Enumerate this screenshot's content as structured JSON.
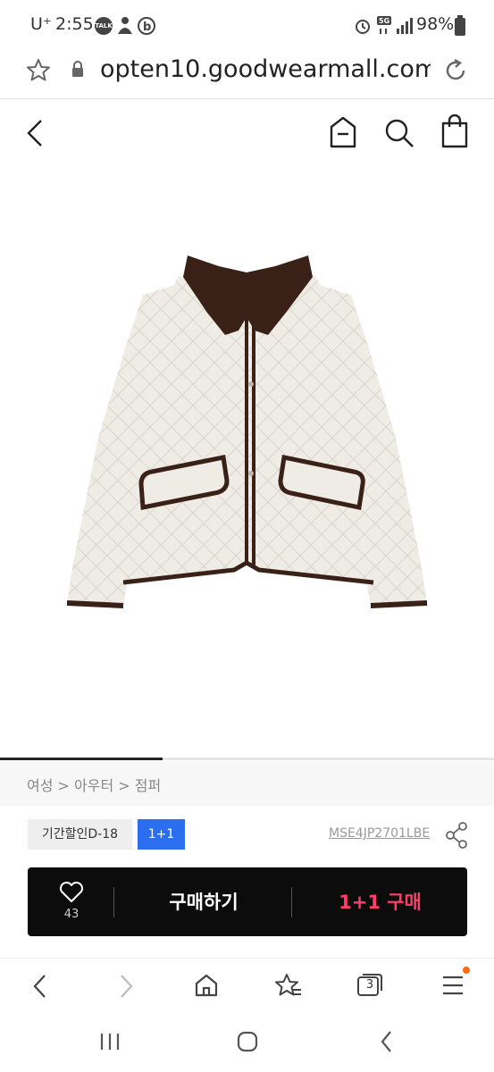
{
  "status_bar": {
    "carrier": "U⁺",
    "time": "2:55",
    "notification_icons": [
      "talk-icon",
      "person-icon",
      "b-icon"
    ],
    "system_icons": [
      "alarm-icon",
      "5g-icon",
      "signal-icon"
    ],
    "talk_text": "TALK",
    "network": "5G",
    "battery_percent": "98%"
  },
  "url_bar": {
    "url": "opten10.goodwearmall.com"
  },
  "header": {
    "icons": [
      "back-icon",
      "home-menu-icon",
      "search-icon",
      "shopping-bag-icon"
    ]
  },
  "product": {
    "image_alt": "ivory diamond-quilted jacket with brown corduroy collar",
    "image_progress": 0.33,
    "colors": {
      "jacket": "#efece6",
      "trim": "#3a2118"
    }
  },
  "breadcrumb": {
    "text": "여성 > 아우터 > 점퍼"
  },
  "tags": {
    "discount": "기간할인D-18",
    "one_plus_one": "1+1",
    "product_code": "MSE4JP2701LBE"
  },
  "buy_bar": {
    "like_count": "43",
    "buy_label": "구매하기",
    "one_plus_one_label": "1+1 구매",
    "accent_color": "#ff3d6a"
  },
  "browser_nav": {
    "tab_count": "3",
    "icons": [
      "back-icon",
      "forward-icon",
      "home-icon",
      "bookmark-add-icon",
      "tabs-icon",
      "menu-icon"
    ]
  },
  "system_nav": {
    "icons": [
      "recent-apps-icon",
      "home-icon",
      "back-icon"
    ]
  }
}
